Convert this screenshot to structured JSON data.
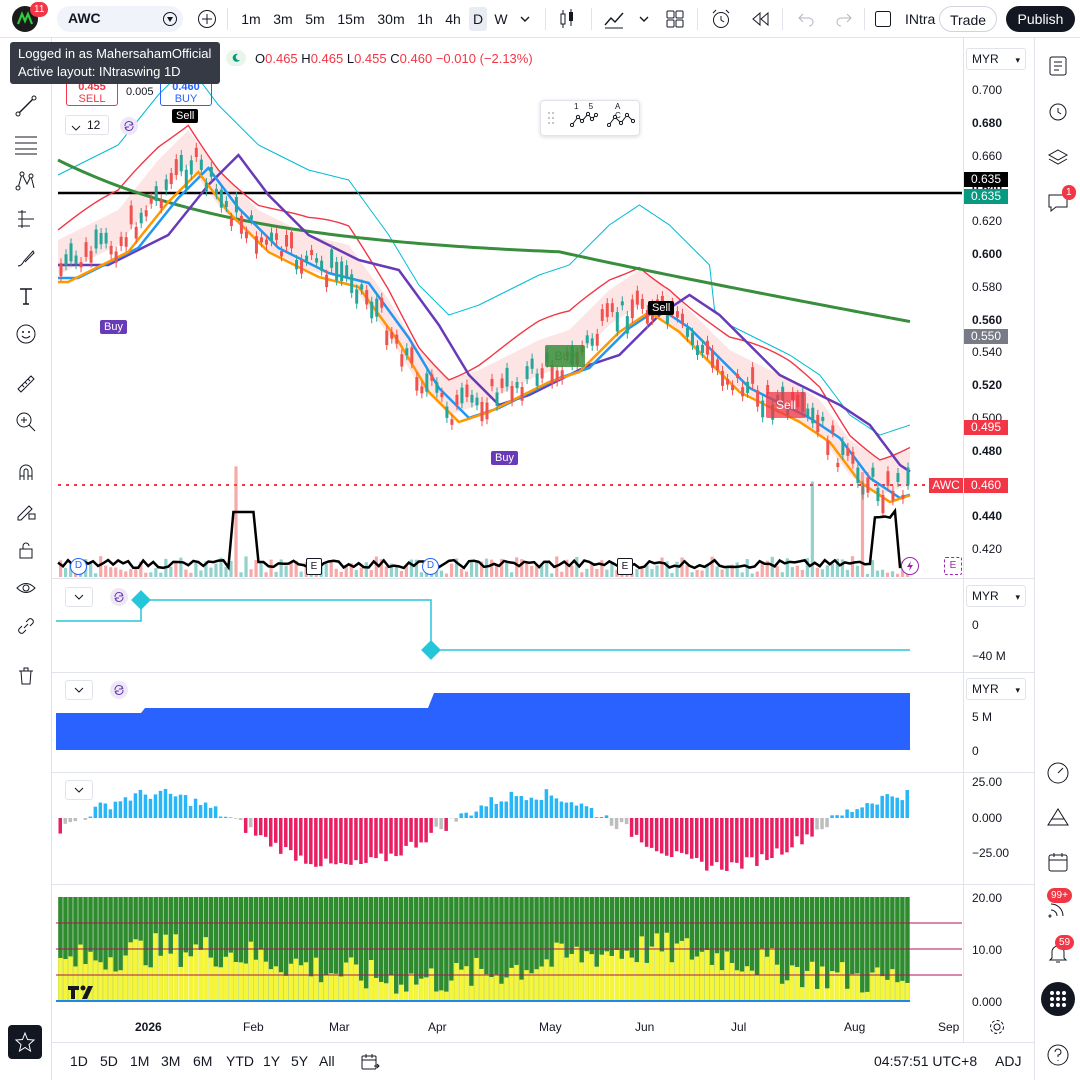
{
  "header": {
    "notif_count": "11",
    "symbol": "AWC",
    "intervals": [
      "1m",
      "3m",
      "5m",
      "15m",
      "30m",
      "1h",
      "4h",
      "D",
      "W"
    ],
    "layout_name": "INtra",
    "trade_label": "Trade",
    "publish_label": "Publish"
  },
  "tooltip": {
    "line1": "Logged in as MahersahamOfficial",
    "line2": "Active layout: INtraswing 1D"
  },
  "ohlc": {
    "o_label": "O",
    "o": "0.465",
    "h_label": "H",
    "h": "0.465",
    "l_label": "L",
    "l": "0.455",
    "c_label": "C",
    "c": "0.460",
    "change": "−0.010 (−2.13%)"
  },
  "trade_widget": {
    "sell_price": "0.455",
    "sell_label": "SELL",
    "spread": "0.005",
    "buy_price": "0.460",
    "buy_label": "BUY"
  },
  "indicator_count": "12",
  "pattern_widget": {
    "a": "1 5",
    "b": "A C"
  },
  "currency": "MYR",
  "price_axis": [
    "0.700",
    "0.680",
    "0.660",
    "0.640",
    "0.620",
    "0.600",
    "0.580",
    "0.560",
    "0.540",
    "0.520",
    "0.500",
    "0.480",
    "0.460",
    "0.440",
    "0.420"
  ],
  "price_tags": {
    "line1": "0.635",
    "line2": "0.635",
    "gray": "0.550",
    "red": "0.495",
    "symbol": "AWC",
    "last": "0.460"
  },
  "signals": {
    "sell1": "Sell",
    "buy1": "Buy",
    "sell2": "Sell",
    "buy2": "Buy",
    "sell3": "Sell",
    "buy3": "Buy"
  },
  "event_markers": {
    "d": "D",
    "e": "E"
  },
  "pane2": {
    "currency": "MYR",
    "axis": [
      "0",
      "−40 M"
    ]
  },
  "pane3": {
    "currency": "MYR",
    "axis": [
      "5 M",
      "0"
    ]
  },
  "pane4": {
    "axis": [
      "25.00",
      "0.000",
      "−25.00"
    ]
  },
  "pane5": {
    "axis": [
      "20.00",
      "10.00",
      "0.000"
    ]
  },
  "time_axis": [
    "2026",
    "Feb",
    "Mar",
    "Apr",
    "May",
    "Jun",
    "Jul",
    "Aug",
    "Sep"
  ],
  "bottom": {
    "ranges": [
      "1D",
      "5D",
      "1M",
      "3M",
      "6M",
      "YTD",
      "1Y",
      "5Y",
      "All"
    ],
    "clock": "04:57:51 UTC+8",
    "adj": "ADJ"
  },
  "right_badges": {
    "chat": "1",
    "news": "99+",
    "alerts": "59"
  },
  "colors": {
    "up": "#26a69a",
    "down": "#ef5350",
    "blue_ma": "#2196f3",
    "orange_ma": "#ff9800",
    "purple_ma": "#673ab7",
    "green_ma": "#388e3c",
    "accent": "#2962ff",
    "buy_badge": "#673ab7"
  }
}
